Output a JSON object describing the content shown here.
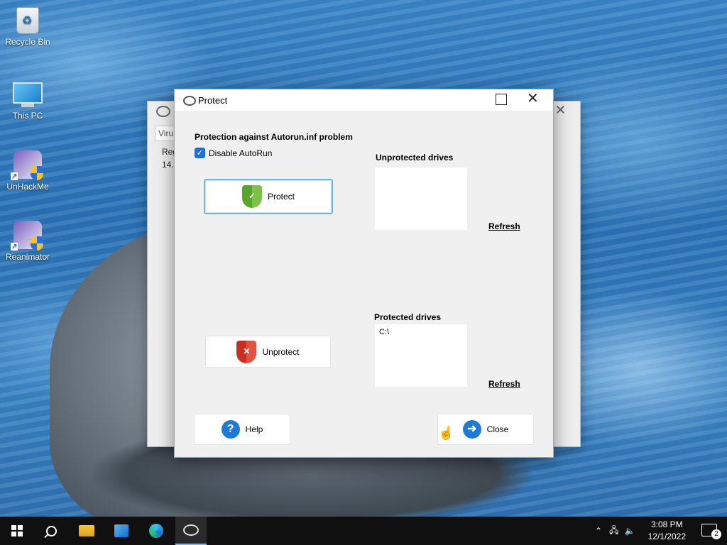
{
  "desktop": {
    "icons": [
      {
        "label": "Recycle Bin"
      },
      {
        "label": "This PC"
      },
      {
        "label": "UnHackMe"
      },
      {
        "label": "Reanimator"
      }
    ]
  },
  "background_window": {
    "tab_label": "Viru",
    "text_line1": "Reg",
    "text_line2": "14."
  },
  "dialog": {
    "title": "Protect",
    "heading": "Protection against Autorun.inf problem",
    "disable_autorun_label": "Disable AutoRun",
    "disable_autorun_checked": true,
    "protect_button": "Protect",
    "unprotect_button": "Unprotect",
    "unprotected_label": "Unprotected drives",
    "unprotected_drives": [],
    "protected_label": "Protected drives",
    "protected_drives": [
      "C:\\"
    ],
    "refresh_label": "Refresh",
    "help_button": "Help",
    "close_button": "Close",
    "icons": {
      "protect": "check-shield-icon",
      "unprotect": "x-shield-icon",
      "help": "question-circle-icon",
      "close": "arrow-circle-icon"
    },
    "colors": {
      "accent": "#1d7ad6",
      "protect_green": "#56a629",
      "unprotect_red": "#c62f22"
    }
  },
  "taskbar": {
    "time": "3:08 PM",
    "date": "12/1/2022",
    "notification_count": "2"
  }
}
